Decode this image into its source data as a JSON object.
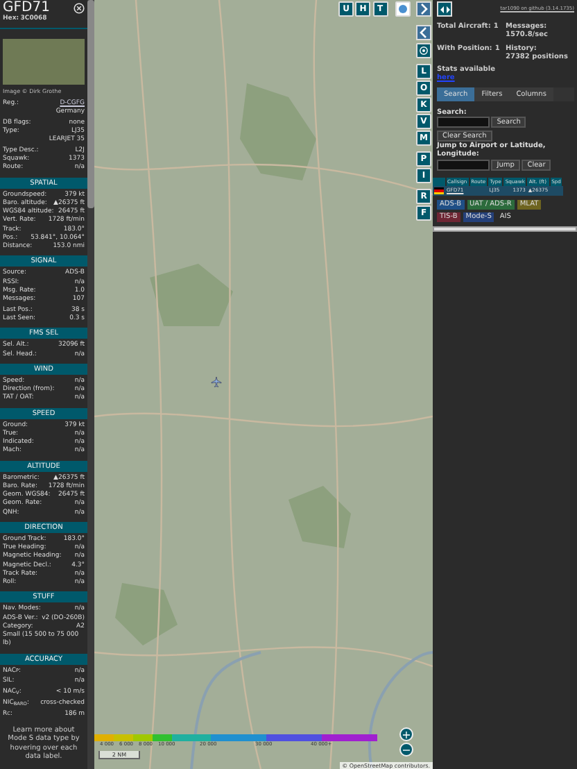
{
  "aircraft": {
    "callsign": "GFD71",
    "hex_label": "Hex:",
    "hex": "3C0068",
    "photo_credit": "Image © Dirk Grothe"
  },
  "sections": [
    {
      "rows": [
        {
          "kind": "pair",
          "label": "Reg.:",
          "value": "D-CGFG",
          "link": true
        },
        {
          "kind": "cont",
          "value": "Germany"
        },
        {
          "kind": "pair",
          "label": "DB flags:",
          "value": "none",
          "gap": true
        },
        {
          "kind": "pair",
          "label": "Type:",
          "value": "LJ35"
        },
        {
          "kind": "cont",
          "value": "LEARJET 35"
        },
        {
          "kind": "pair",
          "label": "Type Desc.:",
          "value": "L2J",
          "gap": true
        },
        {
          "kind": "pair",
          "label": "Squawk:",
          "value": "1373"
        },
        {
          "kind": "pair",
          "label": "Route:",
          "value": "n/a"
        }
      ]
    },
    {
      "title": "SPATIAL",
      "rows": [
        {
          "kind": "pair",
          "label": "Groundspeed:",
          "value": "379 kt"
        },
        {
          "kind": "pair",
          "label": "Baro. altitude:",
          "value": "▲26375 ft"
        },
        {
          "kind": "pair",
          "label": "WGS84 altitude:",
          "value": "26475 ft"
        },
        {
          "kind": "pair",
          "label": "Vert. Rate:",
          "value": "1728 ft/min"
        },
        {
          "kind": "pair",
          "label": "Track:",
          "value": "183.0°"
        },
        {
          "kind": "pair",
          "label": "Pos.:",
          "value": "53.841°, 10.064°"
        },
        {
          "kind": "pair",
          "label": "Distance:",
          "value": "153.0 nmi"
        }
      ]
    },
    {
      "title": "SIGNAL",
      "rows": [
        {
          "kind": "pair",
          "label": "Source:",
          "value": "ADS-B"
        },
        {
          "kind": "pair",
          "label": "RSSI:",
          "value": "n/a"
        },
        {
          "kind": "pair",
          "label": "Msg. Rate:",
          "value": "1.0"
        },
        {
          "kind": "pair",
          "label": "Messages:",
          "value": "107"
        },
        {
          "kind": "pair",
          "label": "Last Pos.:",
          "value": "38 s",
          "gap": true
        },
        {
          "kind": "pair",
          "label": "Last Seen:",
          "value": "0.3 s"
        }
      ]
    },
    {
      "title": "FMS SEL",
      "rows": [
        {
          "kind": "pair",
          "label": "Sel. Alt.:",
          "value": "32096 ft"
        },
        {
          "kind": "pair",
          "label": "Sel. Head.:",
          "value": "n/a"
        }
      ]
    },
    {
      "title": "WIND",
      "rows": [
        {
          "kind": "pair",
          "label": "Speed:",
          "value": "n/a"
        },
        {
          "kind": "pair",
          "label": "Direction (from):",
          "value": "n/a"
        },
        {
          "kind": "pair",
          "label": "TAT / OAT:",
          "value": "n/a"
        }
      ]
    },
    {
      "title": "SPEED",
      "rows": [
        {
          "kind": "pair",
          "label": "Ground:",
          "value": "379 kt"
        },
        {
          "kind": "pair",
          "label": "True:",
          "value": "n/a"
        },
        {
          "kind": "pair",
          "label": "Indicated:",
          "value": "n/a"
        },
        {
          "kind": "pair",
          "label": "Mach:",
          "value": "n/a"
        }
      ]
    },
    {
      "title": "ALTITUDE",
      "rows": [
        {
          "kind": "pair",
          "label": "Barometric:",
          "value": "▲26375 ft"
        },
        {
          "kind": "pair",
          "label": "Baro. Rate:",
          "value": "1728 ft/min"
        },
        {
          "kind": "pair",
          "label": "Geom. WGS84:",
          "value": "26475 ft"
        },
        {
          "kind": "pair",
          "label": "Geom. Rate:",
          "value": "n/a"
        },
        {
          "kind": "pair",
          "label": "QNH:",
          "value": "n/a"
        }
      ]
    },
    {
      "title": "DIRECTION",
      "rows": [
        {
          "kind": "pair",
          "label": "Ground Track:",
          "value": "183.0°"
        },
        {
          "kind": "pair",
          "label": "True Heading:",
          "value": "n/a"
        },
        {
          "kind": "pair",
          "label": "Magnetic Heading:",
          "value": "n/a"
        },
        {
          "kind": "pair",
          "label": "Magnetic Decl.:",
          "value": "4.3°"
        },
        {
          "kind": "pair",
          "label": "Track Rate:",
          "value": "n/a"
        },
        {
          "kind": "pair",
          "label": "Roll:",
          "value": "n/a"
        }
      ]
    },
    {
      "title": "STUFF",
      "rows": [
        {
          "kind": "pair",
          "label": "Nav. Modes:",
          "value": "n/a"
        },
        {
          "kind": "pair",
          "label": "ADS-B Ver.:",
          "value": "v2 (DO-260B)"
        },
        {
          "kind": "pair",
          "label": "Category:",
          "value": "A2"
        },
        {
          "kind": "text",
          "value": "Small (15 500 to 75 000 lb)"
        }
      ]
    },
    {
      "title": "ACCURACY",
      "rows": [
        {
          "kind": "pair",
          "label": "NAC$_{P}$:",
          "value": "n/a"
        },
        {
          "kind": "pair",
          "label": "SIL:",
          "value": "n/a",
          "gap": true
        },
        {
          "kind": "pair",
          "label": "NAC$_{V}$:",
          "value": "< 10 m/s",
          "gap": true
        },
        {
          "kind": "pair",
          "label": "NIC$_{BARO}$:",
          "value": "cross-checked",
          "gap": true
        },
        {
          "kind": "pair",
          "label": "R$_{C}$:",
          "value": "186 m",
          "gap": true
        }
      ]
    }
  ],
  "note": "Learn more about Mode S data type by hovering over each data label.",
  "map": {
    "top_buttons": [
      "U",
      "H",
      "T"
    ],
    "side_button_groups": [
      [
        "L",
        "O",
        "K",
        "V",
        "M"
      ],
      [
        "P",
        "I"
      ],
      [
        "R",
        "F"
      ]
    ],
    "altitude_scale": [
      "4 000",
      "6 000",
      "8 000",
      "10 000",
      "20 000",
      "30 000",
      "40 000+"
    ],
    "scale_bar": "2 NM",
    "zoom_buttons": [
      "+",
      "−"
    ],
    "attribution_prefix": "©",
    "attribution_link": "OpenStreetMap",
    "attribution_suffix": "contributors."
  },
  "panel": {
    "version": "tar1090 on github (3.14.1735)",
    "stats": [
      {
        "label": "Total Aircraft:",
        "value": "1"
      },
      {
        "label": "Messages:",
        "value": "1570.8/sec"
      },
      {
        "label": "With Position:",
        "value": "1"
      },
      {
        "label": "History:",
        "value": "27382 positions"
      }
    ],
    "stats_text": "Stats available",
    "stats_link": "here",
    "tabs": [
      {
        "label": "Search",
        "selected": true
      },
      {
        "label": "Filters",
        "selected": false
      },
      {
        "label": "Columns",
        "selected": false
      }
    ],
    "search_label": "Search:",
    "search_button": "Search",
    "clear_search": "Clear Search",
    "jump_label": "Jump to Airport or Latitude, Longitude:",
    "jump_button": "Jump",
    "clear_button": "Clear",
    "columns": [
      "Callsign",
      "Route",
      "Type",
      "Squawk",
      "Alt. (ft)",
      "Spd"
    ],
    "rows": [
      {
        "selected": true,
        "callsign": "GFD71",
        "type": "LJ35",
        "squawk": "1373",
        "altitude": "▲26375"
      }
    ],
    "legend": [
      {
        "label": "ADS-B",
        "color": "#1f4f86"
      },
      {
        "label": "UAT / ADS-R",
        "color": "#2c6b3c"
      },
      {
        "label": "MLAT",
        "color": "#6e6420"
      },
      {
        "label": "TIS-B",
        "color": "#6e2634"
      },
      {
        "label": "Mode-S",
        "color": "#24407a"
      },
      {
        "label": "AIS"
      }
    ]
  }
}
